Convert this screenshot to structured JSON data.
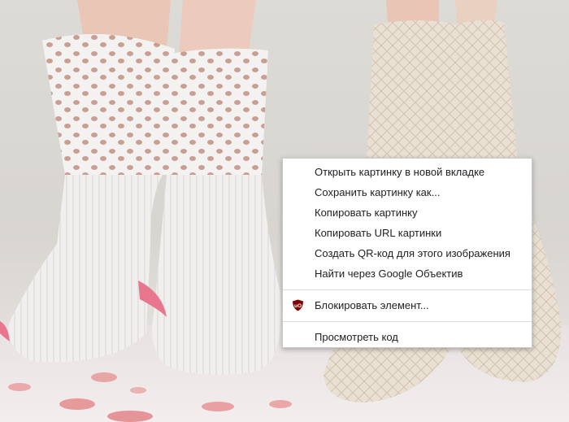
{
  "background": {
    "subject": "knitted-socks-photo"
  },
  "context_menu": {
    "items": [
      {
        "label": "Открыть картинку в новой вкладке"
      },
      {
        "label": "Сохранить картинку как..."
      },
      {
        "label": "Копировать картинку"
      },
      {
        "label": "Копировать URL картинки"
      },
      {
        "label": "Создать QR-код для этого изображения"
      },
      {
        "label": "Найти через Google Объектив"
      }
    ],
    "extension_item": {
      "label": "Блокировать элемент...",
      "icon": "ublock-origin-icon",
      "icon_text": "uO",
      "icon_color": "#800000"
    },
    "inspect_item": {
      "label": "Просмотреть код"
    }
  }
}
